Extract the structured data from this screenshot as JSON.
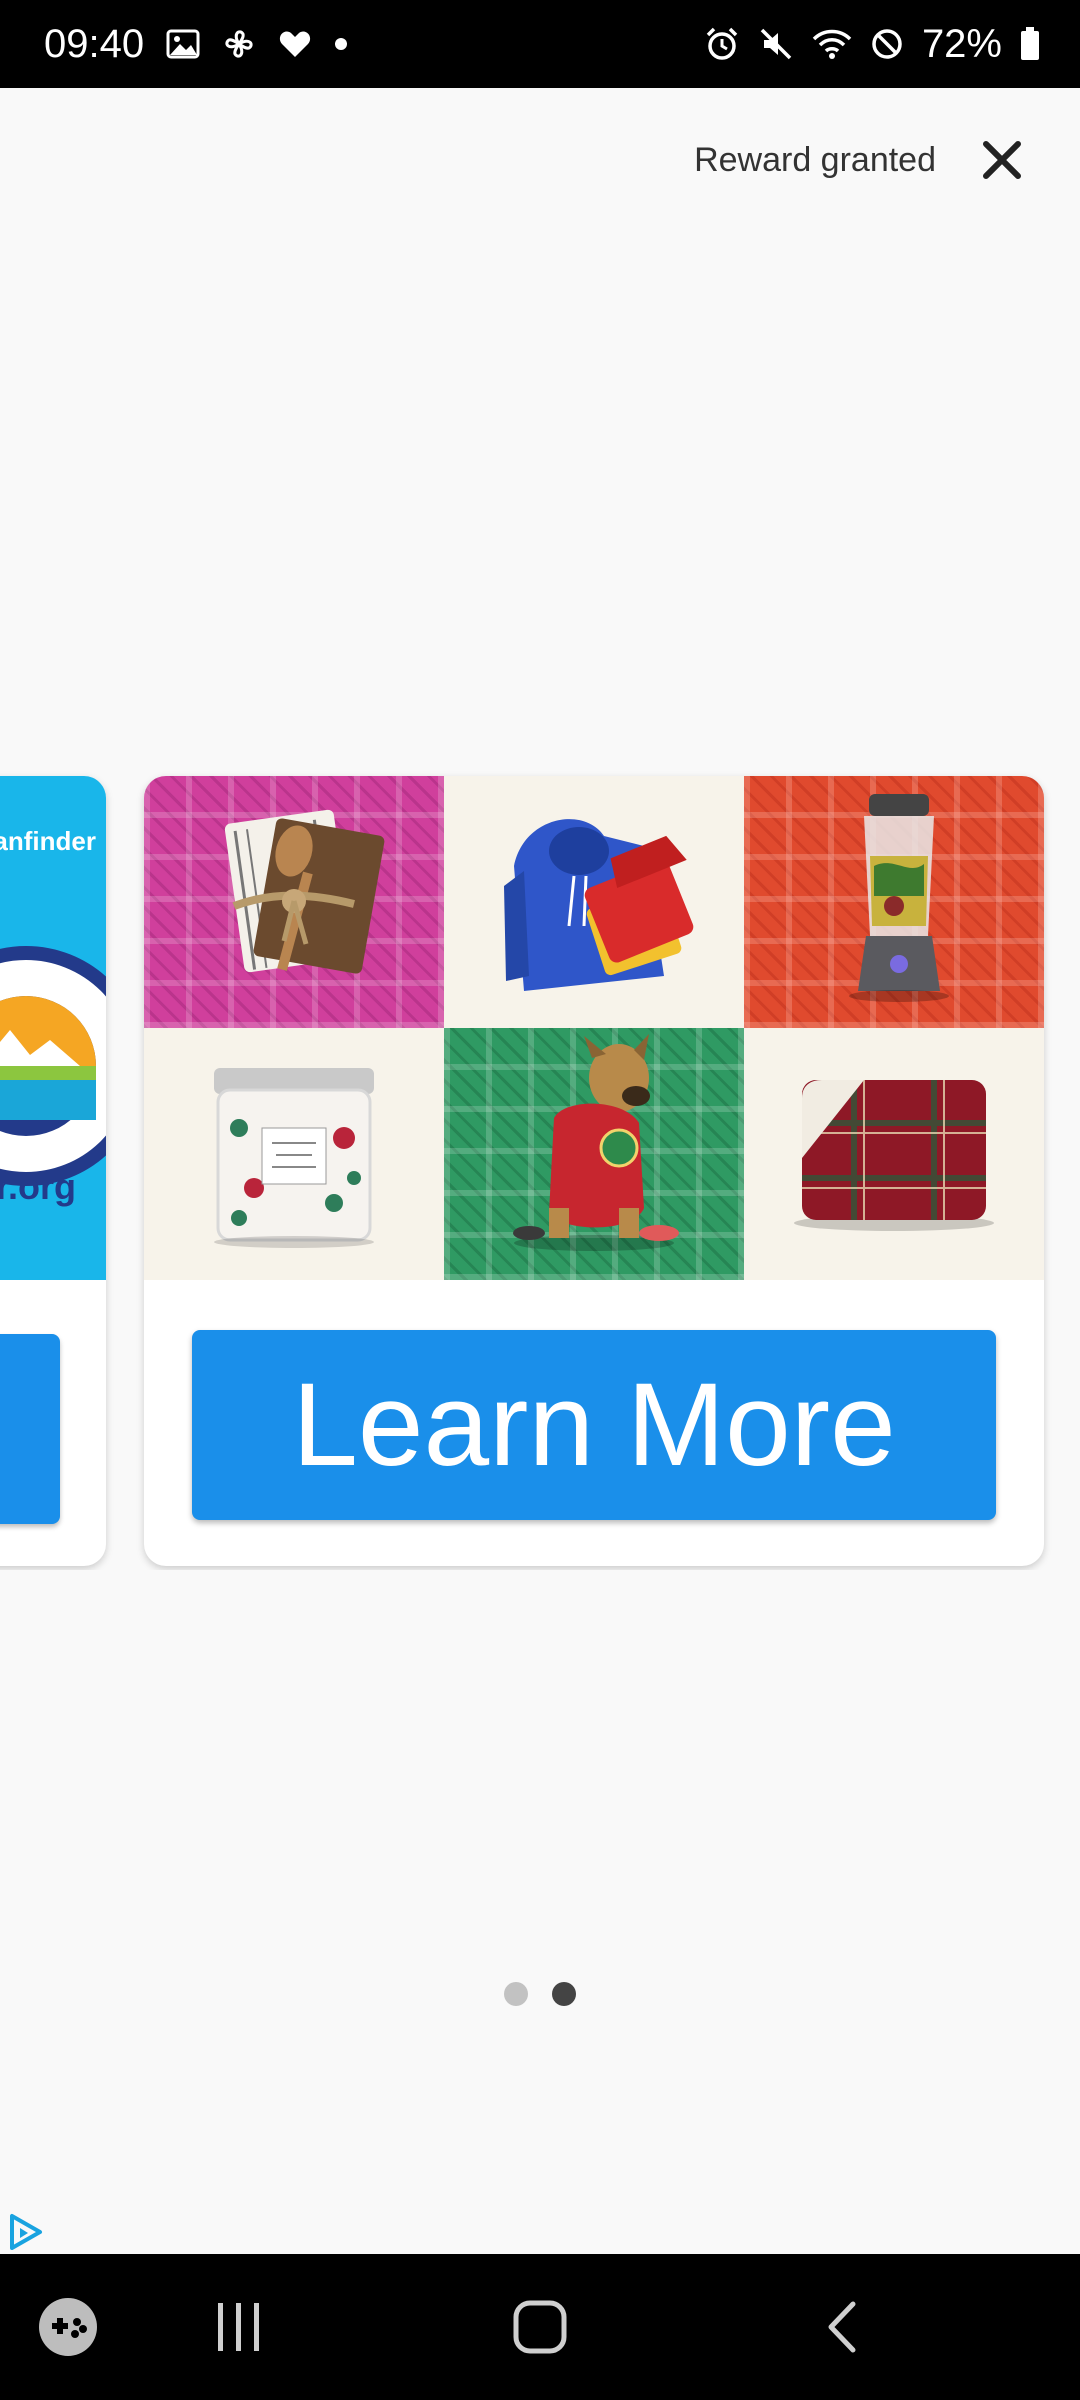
{
  "status_bar": {
    "time": "09:40",
    "battery": "72%",
    "left_icons": [
      "image-icon",
      "pinwheel-icon",
      "heart-icon",
      "dot-icon"
    ],
    "right_icons": [
      "alarm-icon",
      "mute-icon",
      "wifi-icon",
      "do-not-disturb-icon",
      "battery-icon"
    ]
  },
  "header": {
    "reward_text": "Reward granted",
    "close_icon": "close-icon"
  },
  "carousel": {
    "previous_card": {
      "brand_text": "anfinder",
      "domain_text": "r.org"
    },
    "main_card": {
      "products": [
        "towels-icon",
        "hoodie-icon",
        "blender-icon",
        "candle-icon",
        "dog-sweater-icon",
        "plaid-blanket-icon"
      ],
      "cta_label": "Learn More"
    },
    "page_count": 2,
    "active_page": 2
  },
  "ad_choices_icon": "adchoices-icon",
  "nav_bar": {
    "items": [
      "game-launcher-icon",
      "recent-apps-icon",
      "home-icon",
      "back-icon"
    ]
  },
  "colors": {
    "cta": "#1a8fea",
    "background": "#f9f9f9",
    "prev_card_bg": "#19b6ea"
  }
}
